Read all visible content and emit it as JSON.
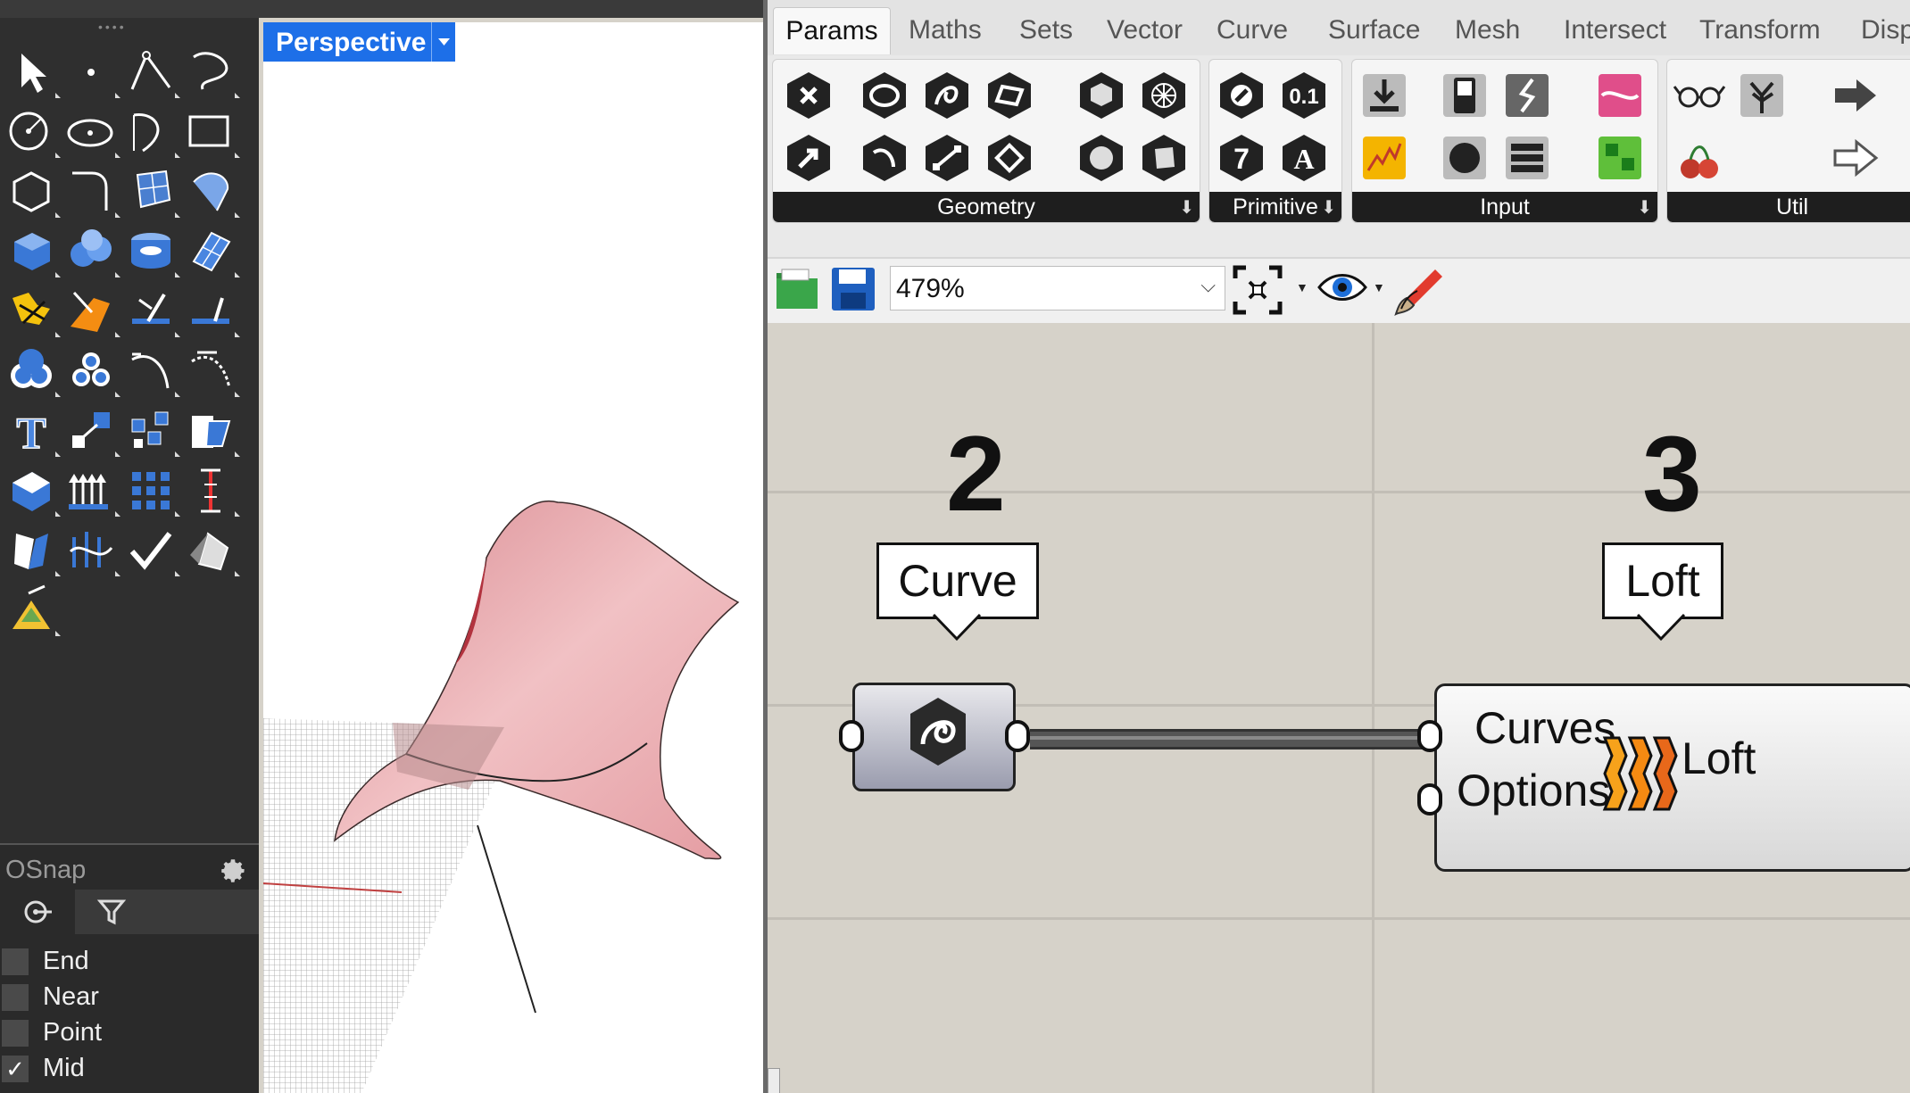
{
  "rhino": {
    "toolbar_icons": [
      "select-arrow-icon",
      "point-icon",
      "polyline-icon",
      "curve-icon",
      "circle-icon",
      "ellipse-icon",
      "arc-icon",
      "rectangle-icon",
      "polygon-icon",
      "fillet-curve-icon",
      "surface-from-points-icon",
      "extrude-curve-icon",
      "box-icon",
      "sphere-icon",
      "cylinder-icon",
      "plane-surface-icon",
      "explode-icon",
      "split-icon",
      "trim-icon",
      "join-icon",
      "boolean-union-icon",
      "boolean-split-icon",
      "offset-curve-icon",
      "offset-surface-icon",
      "text-icon",
      "scale-icon",
      "array-icon",
      "transform-icon",
      "solid-tools-icon",
      "extrude-vertical-icon",
      "grid-array-icon",
      "dimension-icon",
      "analyze-icon",
      "curve-tools-icon",
      "check-icon",
      "render-mesh-icon",
      "lights-icon"
    ],
    "viewport": {
      "title": "Perspective"
    },
    "osnap": {
      "title": "OSnap",
      "items": [
        {
          "label": "End",
          "checked": false
        },
        {
          "label": "Near",
          "checked": false
        },
        {
          "label": "Point",
          "checked": false
        },
        {
          "label": "Mid",
          "checked": true
        }
      ]
    }
  },
  "grasshopper": {
    "tabs": [
      "Params",
      "Maths",
      "Sets",
      "Vector",
      "Curve",
      "Surface",
      "Mesh",
      "Intersect",
      "Transform",
      "Disp"
    ],
    "active_tab": "Params",
    "groups": [
      {
        "label": "Geometry"
      },
      {
        "label": "Primitive"
      },
      {
        "label": "Input"
      },
      {
        "label": "Util"
      }
    ],
    "zoom": "479%",
    "canvas": {
      "annotation_numbers": [
        "2",
        "3"
      ],
      "curve_callout": "Curve",
      "loft_callout": "Loft",
      "loft_component": {
        "inputs": [
          "Curves",
          "Options"
        ],
        "output": "Loft"
      }
    }
  },
  "colors": {
    "accent_blue": "#1d6fe8",
    "surface_pink": "#e6a3a8",
    "toolbar_dark": "#2f2f2f",
    "canvas_bg": "#d6d2c9"
  }
}
